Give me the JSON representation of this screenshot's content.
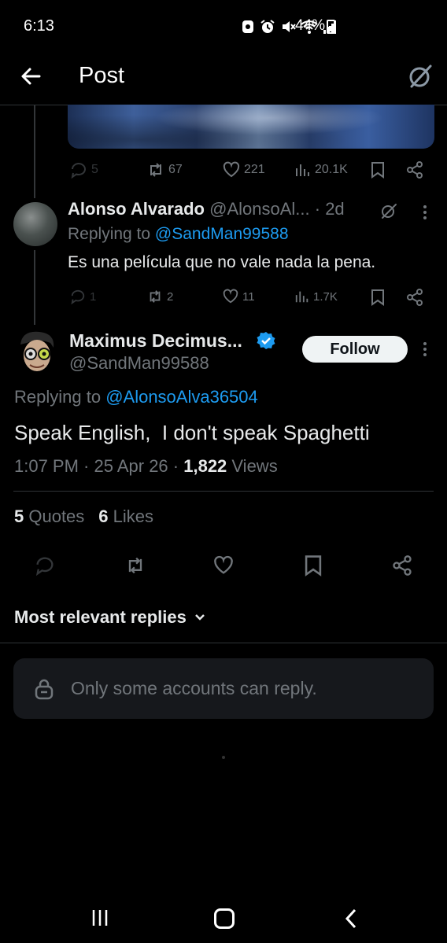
{
  "status_bar": {
    "time": "6:13",
    "battery": "44%"
  },
  "header": {
    "title": "Post"
  },
  "parent_actions": {
    "replies": "5",
    "reposts": "67",
    "likes": "221",
    "views": "20.1K"
  },
  "reply1": {
    "name": "Alonso Alvarado",
    "handle": "@AlonsoAl...",
    "age": "· 2d",
    "replying_prefix": "Replying to ",
    "replying_handle": "@SandMan99588",
    "text": "Es una película que no vale nada la pena.",
    "actions": {
      "replies": "1",
      "reposts": "2",
      "likes": "11",
      "views": "1.7K"
    }
  },
  "main_post": {
    "name": "Maximus Decimus...",
    "handle": "@SandMan99588",
    "follow_label": "Follow",
    "replying_prefix": "Replying to ",
    "replying_handle": "@AlonsoAlva36504",
    "text": "Speak English,  I don't speak Spaghetti",
    "time": "1:07 PM · 25 Apr 26 · ",
    "views_count": "1,822",
    "views_label": " Views",
    "quotes_count": "5",
    "quotes_label": " Quotes",
    "likes_count": "6",
    "likes_label": " Likes"
  },
  "replies_filter": {
    "label": "Most relevant replies"
  },
  "reply_restriction": {
    "text": "Only some accounts can reply."
  },
  "colors": {
    "accent": "#1d9bf0",
    "background": "#000000",
    "muted": "#71767b",
    "text": "#e7e9ea"
  }
}
